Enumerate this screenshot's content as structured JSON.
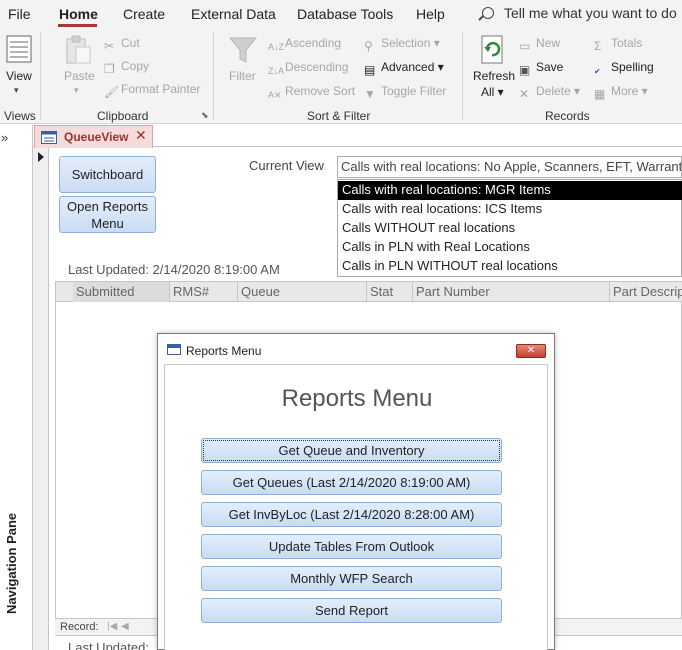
{
  "menu": {
    "tabs": [
      "File",
      "Home",
      "Create",
      "External Data",
      "Database Tools",
      "Help"
    ],
    "tell_me": "Tell me what you want to do"
  },
  "ribbon": {
    "views": {
      "view_label": "View",
      "group": "Views"
    },
    "clipboard": {
      "paste": "Paste",
      "cut": "Cut",
      "copy": "Copy",
      "format_painter": "Format Painter",
      "group": "Clipboard"
    },
    "sort_filter": {
      "filter": "Filter",
      "ascending": "Ascending",
      "descending": "Descending",
      "remove_sort": "Remove Sort",
      "selection": "Selection",
      "advanced": "Advanced",
      "toggle_filter": "Toggle Filter",
      "group": "Sort & Filter"
    },
    "records": {
      "refresh": "Refresh",
      "refresh_all": "All",
      "new": "New",
      "save": "Save",
      "delete": "Delete",
      "totals": "Totals",
      "spelling": "Spelling",
      "more": "More",
      "group": "Records"
    }
  },
  "nav_pane": {
    "label": "Navigation Pane"
  },
  "document_tab": {
    "label": "QueueView"
  },
  "form": {
    "switchboard_button": "Switchboard",
    "open_reports_line1": "Open Reports",
    "open_reports_line2": "Menu",
    "current_view_label": "Current View",
    "current_view_value": "Calls with real locations: No Apple, Scanners, EFT, Warranty",
    "view_options": [
      "Calls with real locations: MGR Items",
      "Calls with real locations: ICS Items",
      "Calls WITHOUT real locations",
      "Calls in PLN with Real Locations",
      "Calls in PLN WITHOUT real locations"
    ],
    "last_updated": "Last Updated: 2/14/2020 8:19:00 AM",
    "last_updated_partial": "Last Updated:",
    "columns": [
      "Submitted",
      "RMS#",
      "Queue",
      "Stat",
      "Part Number",
      "Part Description"
    ],
    "record_label": "Record:"
  },
  "popup": {
    "title": "Reports Menu",
    "heading": "Reports Menu",
    "buttons": [
      "Get Queue and Inventory",
      "Get Queues (Last 2/14/2020 8:19:00 AM)",
      "Get InvByLoc (Last 2/14/2020 8:28:00 AM)",
      "Update Tables From Outlook",
      "Monthly WFP Search",
      "Send Report"
    ]
  }
}
